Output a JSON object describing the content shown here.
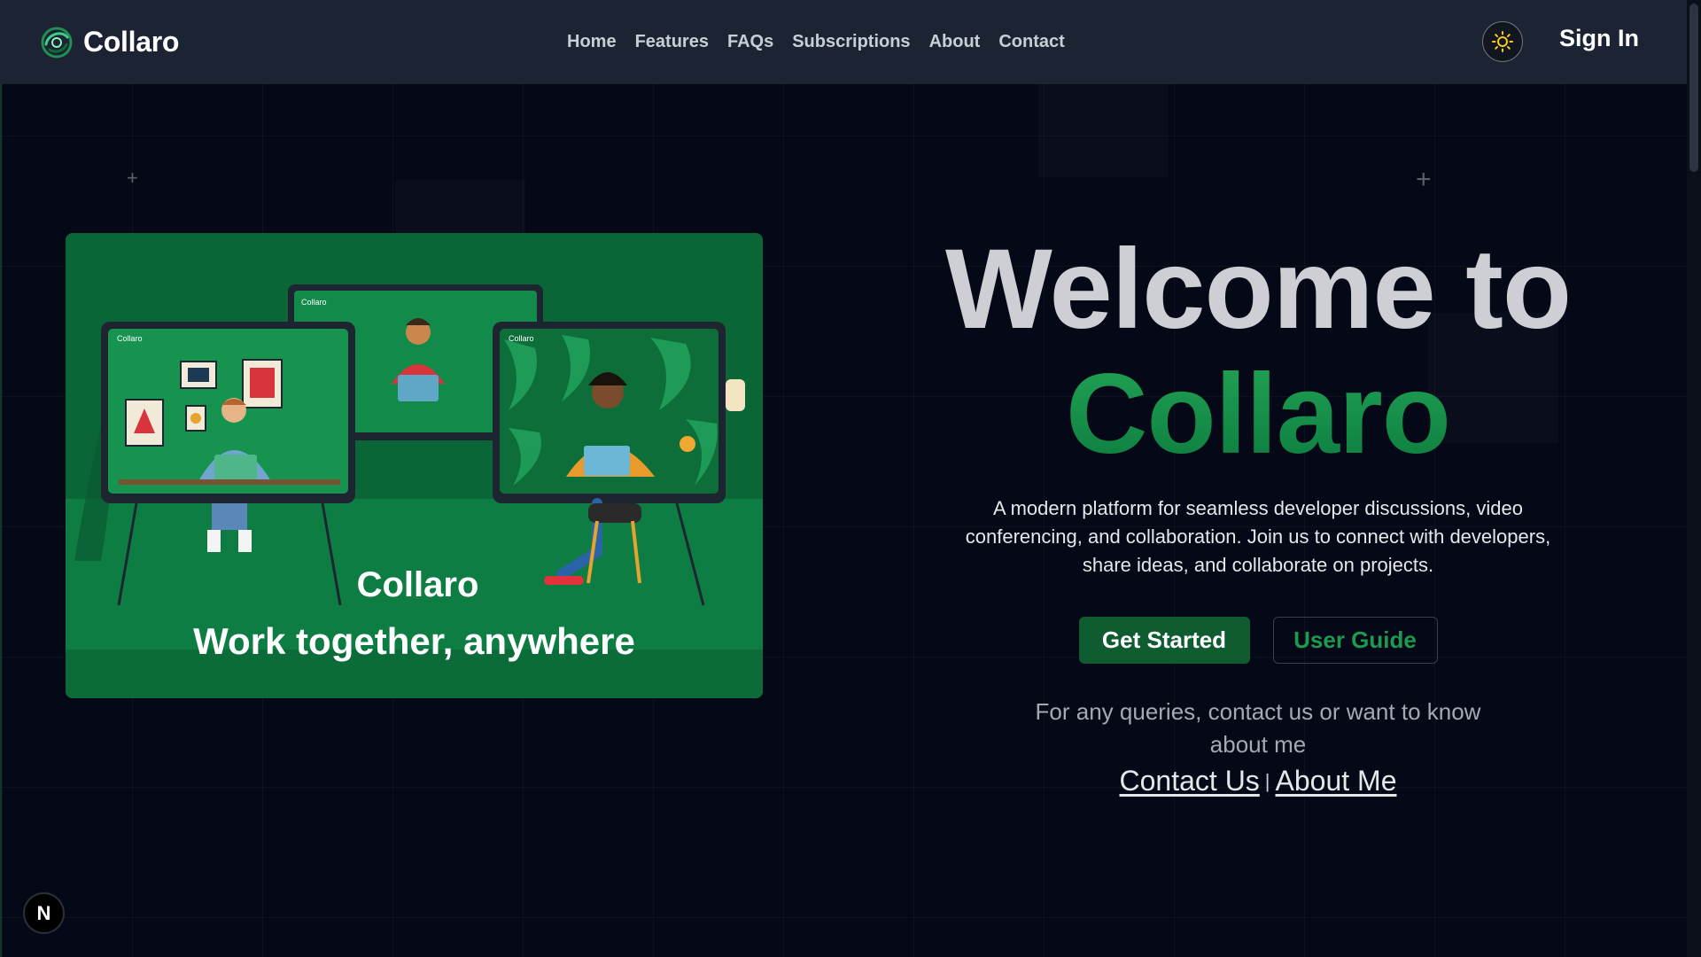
{
  "navbar": {
    "brand_name": "Collaro",
    "links": [
      "Home",
      "Features",
      "FAQs",
      "Subscriptions",
      "About",
      "Contact"
    ],
    "sign_in_label": "Sign In",
    "theme_icon": "sun-icon"
  },
  "hero_image": {
    "caption_brand": "Collaro",
    "caption_tagline": "Work together, anywhere",
    "screen_label": "Collaro"
  },
  "hero": {
    "heading_line1": "Welcome to",
    "heading_line2": "Collaro",
    "description": "A modern platform for seamless developer discussions, video conferencing, and collaboration. Join us to connect with developers, share ideas, and collaborate on projects.",
    "primary_cta": "Get Started",
    "secondary_cta": "User Guide",
    "query_text": "For any queries, contact us or want to know about me",
    "contact_link": "Contact Us",
    "separator": "|",
    "about_link": "About Me"
  },
  "dev_indicator": {
    "label": "N"
  },
  "colors": {
    "background": "#050816",
    "navbar": "#1c2433",
    "brand_green": "#0f5c31",
    "accent_green": "#1c9a4f"
  }
}
